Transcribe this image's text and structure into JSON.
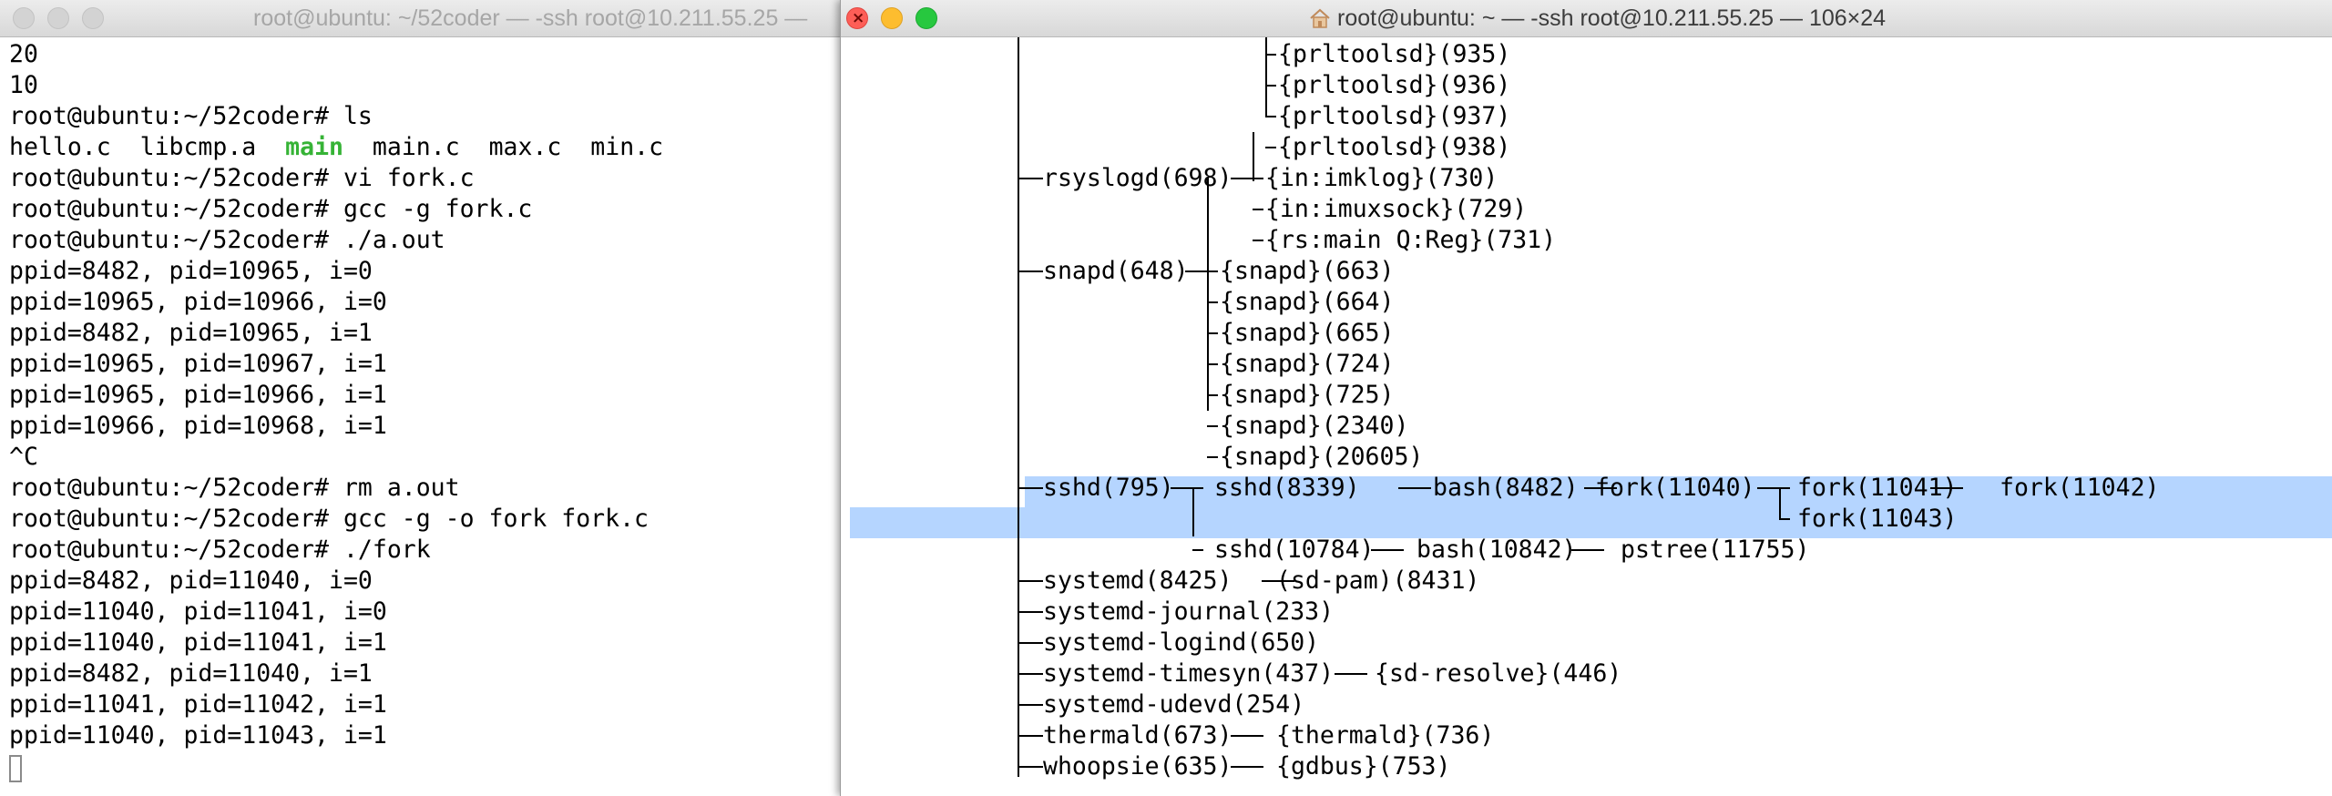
{
  "left_window": {
    "title": "root@ubuntu: ~/52coder — -ssh root@10.211.55.25 —",
    "lines": [
      "20",
      "10",
      "root@ubuntu:~/52coder# ls",
      "",
      "root@ubuntu:~/52coder# vi fork.c",
      "root@ubuntu:~/52coder# gcc -g fork.c",
      "root@ubuntu:~/52coder# ./a.out",
      "ppid=8482, pid=10965, i=0",
      "ppid=10965, pid=10966, i=0",
      "ppid=8482, pid=10965, i=1",
      "ppid=10965, pid=10967, i=1",
      "ppid=10965, pid=10966, i=1",
      "ppid=10966, pid=10968, i=1",
      "^C",
      "root@ubuntu:~/52coder# rm a.out",
      "root@ubuntu:~/52coder# gcc -g -o fork fork.c",
      "root@ubuntu:~/52coder# ./fork",
      "ppid=8482, pid=11040, i=0",
      "ppid=11040, pid=11041, i=0",
      "ppid=11040, pid=11041, i=1",
      "ppid=8482, pid=11040, i=1",
      "ppid=11041, pid=11042, i=1",
      "ppid=11040, pid=11043, i=1"
    ],
    "ls_output": {
      "f1": "hello.c",
      "f2": "libcmp.a",
      "f3": "main",
      "f4": "main.c",
      "f5": "max.c",
      "f6": "min.c"
    },
    "executable_color": "#36b336"
  },
  "right_window": {
    "title": "root@ubuntu: ~ — -ssh root@10.211.55.25 — 106×24",
    "tree_lines": [
      "{prltoolsd}(935)",
      "{prltoolsd}(936)",
      "{prltoolsd}(937)",
      "{prltoolsd}(938)",
      "rsyslogd(698)",
      "{in:imklog}(730)",
      "{in:imuxsock}(729)",
      "{rs:main Q:Reg}(731)",
      "snapd(648)",
      "{snapd}(663)",
      "{snapd}(664)",
      "{snapd}(665)",
      "{snapd}(724)",
      "{snapd}(725)",
      "{snapd}(2340)",
      "{snapd}(20605)",
      "sshd(795)",
      "sshd(8339)",
      "bash(8482)",
      "fork(11040)",
      "fork(11041)",
      "fork(11042)",
      "fork(11043)",
      "sshd(10784)",
      "bash(10842)",
      "pstree(11755)",
      "systemd(8425)",
      "(sd-pam)(8431)",
      "systemd-journal(233)",
      "systemd-logind(650)",
      "systemd-timesyn(437)",
      "{sd-resolve}(446)",
      "systemd-udevd(254)",
      "thermald(673)",
      "{thermald}(736)",
      "whoopsie(635)",
      "{gdbus}(753)"
    ],
    "selection_color": "#b5d5ff"
  }
}
